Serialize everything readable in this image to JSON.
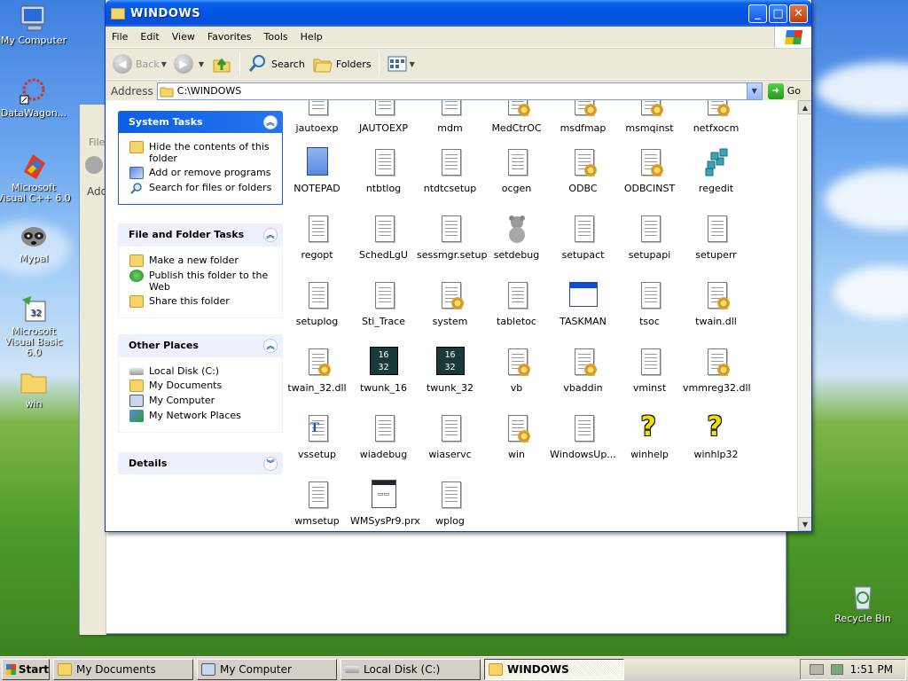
{
  "desktop": {
    "icons": [
      {
        "label": "My Computer"
      },
      {
        "label": "DataWagon..."
      },
      {
        "label": "Microsoft Visual C++ 6.0"
      },
      {
        "label": "Mypal"
      },
      {
        "label": "Microsoft Visual Basic 6.0"
      },
      {
        "label": "win"
      },
      {
        "label": "Recycle Bin"
      }
    ],
    "bg_window_fragments": [
      "File",
      "Add"
    ]
  },
  "window": {
    "title": "WINDOWS",
    "menu": [
      "File",
      "Edit",
      "View",
      "Favorites",
      "Tools",
      "Help"
    ],
    "toolbar": {
      "back": "Back",
      "search": "Search",
      "folders": "Folders"
    },
    "address": {
      "label": "Address",
      "value": "C:\\WINDOWS",
      "go": "Go"
    }
  },
  "left_pane": {
    "system_tasks": {
      "title": "System Tasks",
      "items": [
        "Hide the contents of this folder",
        "Add or remove programs",
        "Search for files or folders"
      ]
    },
    "file_folder_tasks": {
      "title": "File and Folder Tasks",
      "items": [
        "Make a new folder",
        "Publish this folder to the Web",
        "Share this folder"
      ]
    },
    "other_places": {
      "title": "Other Places",
      "items": [
        "Local Disk (C:)",
        "My Documents",
        "My Computer",
        "My Network Places"
      ]
    },
    "details": {
      "title": "Details"
    }
  },
  "files": [
    [
      "jautoexp",
      "JAUTOEXP",
      "mdm",
      "MedCtrOC",
      "msdfmap",
      "msmqinst",
      "netfxocm"
    ],
    [
      "NOTEPAD",
      "ntbtlog",
      "ntdtcsetup",
      "ocgen",
      "ODBC",
      "ODBCINST",
      "regedit"
    ],
    [
      "regopt",
      "SchedLgU",
      "sessmgr.setup",
      "setdebug",
      "setupact",
      "setupapi",
      "setuperr"
    ],
    [
      "setuplog",
      "Sti_Trace",
      "system",
      "tabletoc",
      "TASKMAN",
      "tsoc",
      "twain.dll"
    ],
    [
      "twain_32.dll",
      "twunk_16",
      "twunk_32",
      "vb",
      "vbaddin",
      "vminst",
      "vmmreg32.dll"
    ],
    [
      "vssetup",
      "wiadebug",
      "wiaservc",
      "win",
      "WindowsUp...",
      "winhelp",
      "winhlp32"
    ],
    [
      "wmsetup",
      "WMSysPr9.prx",
      "wplog"
    ]
  ],
  "taskbar": {
    "start": "Start",
    "tasks": [
      "My Documents",
      "My Computer",
      "Local Disk (C:)",
      "WINDOWS"
    ],
    "clock": "1:51 PM"
  },
  "colors": {
    "titlebar": "#0054e3",
    "panel_blue": "#0c5fe6",
    "taskbar": "#d4d0c8"
  }
}
